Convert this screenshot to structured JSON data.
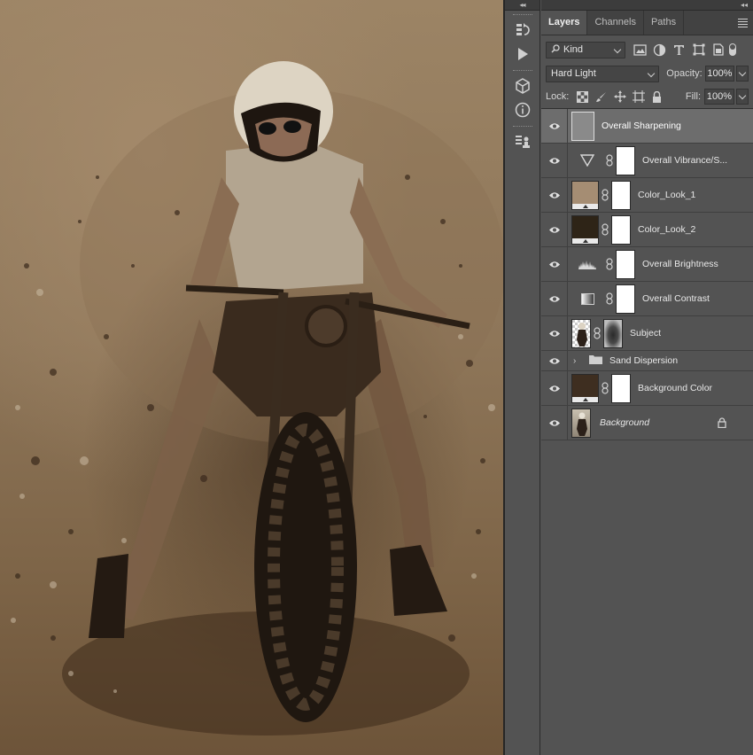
{
  "canvas": {
    "description_icon": "photo-canvas"
  },
  "panel": {
    "tabs": [
      {
        "label": "Layers",
        "active": true
      },
      {
        "label": "Channels",
        "active": false
      },
      {
        "label": "Paths",
        "active": false
      }
    ],
    "filter": {
      "kind_label": "Kind"
    },
    "blend_mode": "Hard Light",
    "opacity_label": "Opacity:",
    "opacity_value": "100%",
    "lock_label": "Lock:",
    "fill_label": "Fill:",
    "fill_value": "100%",
    "layers": [
      {
        "name": "Overall Sharpening",
        "type": "smart-gray",
        "selected": true
      },
      {
        "name": "Overall Vibrance/S...",
        "type": "adj-vibrance"
      },
      {
        "name": "Color_Look_1",
        "type": "fill-tan"
      },
      {
        "name": "Color_Look_2",
        "type": "fill-dark"
      },
      {
        "name": "Overall Brightness",
        "type": "adj-levels"
      },
      {
        "name": "Overall Contrast",
        "type": "adj-gradient"
      },
      {
        "name": "Subject",
        "type": "pixel-masked"
      },
      {
        "name": "Sand Dispersion",
        "type": "group"
      },
      {
        "name": "Background Color",
        "type": "fill-brown"
      },
      {
        "name": "Background",
        "type": "background-locked"
      }
    ]
  },
  "colors": {
    "fill_tan": "#a58d73",
    "fill_dark": "#2e2417",
    "fill_brown": "#3e2e20",
    "smart_gray": "#8a8a8a",
    "panel_bg": "#535353",
    "selected_row": "#6d6d6d"
  }
}
